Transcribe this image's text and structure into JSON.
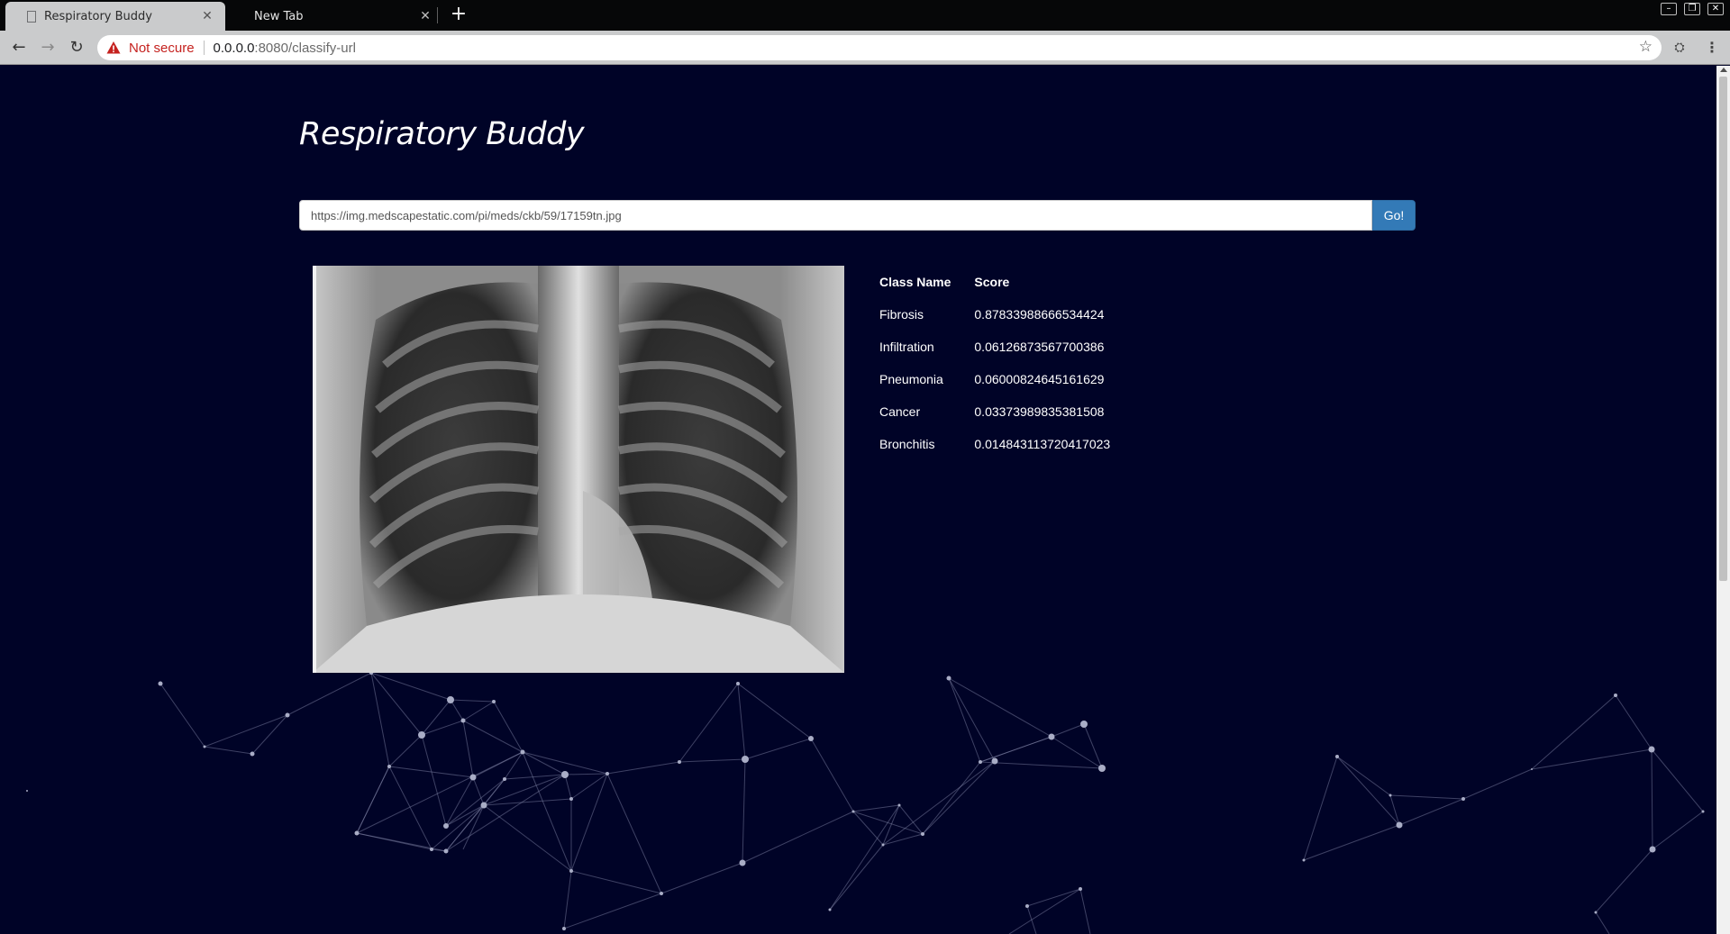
{
  "browser": {
    "tabs": [
      {
        "label": "Respiratory Buddy",
        "active": true
      },
      {
        "label": "New Tab",
        "active": false
      }
    ],
    "security_label": "Not secure",
    "url_host": "0.0.0.0",
    "url_rest": ":8080/classify-url"
  },
  "page": {
    "title": "Respiratory Buddy",
    "url_input": {
      "value": "https://img.medscapestatic.com/pi/meds/ckb/59/17159tn.jpg",
      "placeholder": ""
    },
    "submit_label": "Go!",
    "results": {
      "headers": [
        "Class Name",
        "Score"
      ],
      "rows": [
        {
          "name": "Fibrosis",
          "score": "0.87833988666534424"
        },
        {
          "name": "Infiltration",
          "score": "0.06126873567700386"
        },
        {
          "name": "Pneumonia",
          "score": "0.06000824645161629"
        },
        {
          "name": "Cancer",
          "score": "0.03373989835381508"
        },
        {
          "name": "Bronchitis",
          "score": "0.014843113720417023"
        }
      ]
    }
  },
  "colors": {
    "page_background": "#000327",
    "button_primary": "#337ab7",
    "particle_line": "#8a8fb0"
  }
}
